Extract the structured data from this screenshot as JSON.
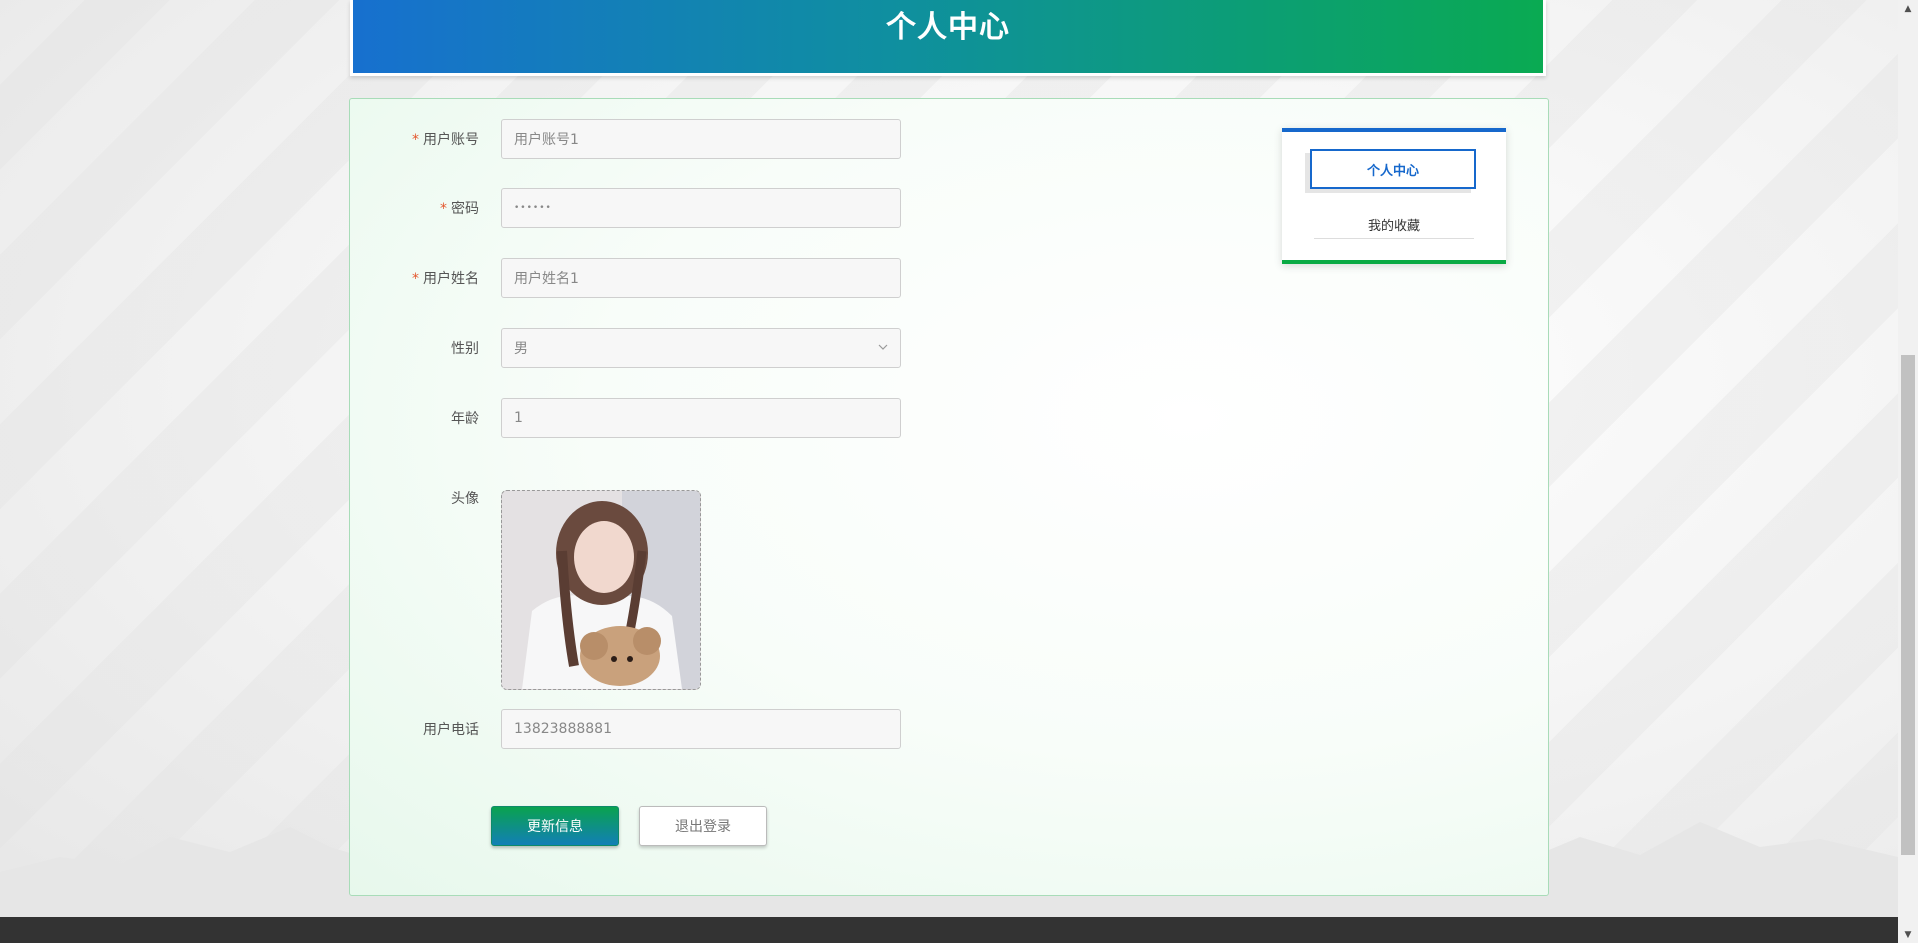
{
  "header": {
    "title": "个人中心"
  },
  "form": {
    "account": {
      "label": "用户账号",
      "required": true,
      "value": "用户账号1"
    },
    "password": {
      "label": "密码",
      "required": true,
      "value": "••••••"
    },
    "name": {
      "label": "用户姓名",
      "required": true,
      "value": "用户姓名1"
    },
    "gender": {
      "label": "性别",
      "value": "男"
    },
    "age": {
      "label": "年龄",
      "value": "1"
    },
    "avatar": {
      "label": "头像"
    },
    "phone": {
      "label": "用户电话",
      "value": "13823888881"
    },
    "required_mark": "*"
  },
  "buttons": {
    "update": "更新信息",
    "logout": "退出登录"
  },
  "side_menu": {
    "items": [
      {
        "label": "个人中心",
        "active": true
      },
      {
        "label": "我的收藏",
        "active": false
      }
    ]
  },
  "colors": {
    "banner_start": "#1770cf",
    "banner_end": "#0aaa52",
    "accent_blue": "#1668cc",
    "accent_green": "#0aaa44",
    "required": "#e4572e"
  },
  "icons": {
    "select": "chevron-down-icon",
    "scroll_up": "scroll-up-arrow-icon",
    "scroll_down": "scroll-down-arrow-icon"
  }
}
